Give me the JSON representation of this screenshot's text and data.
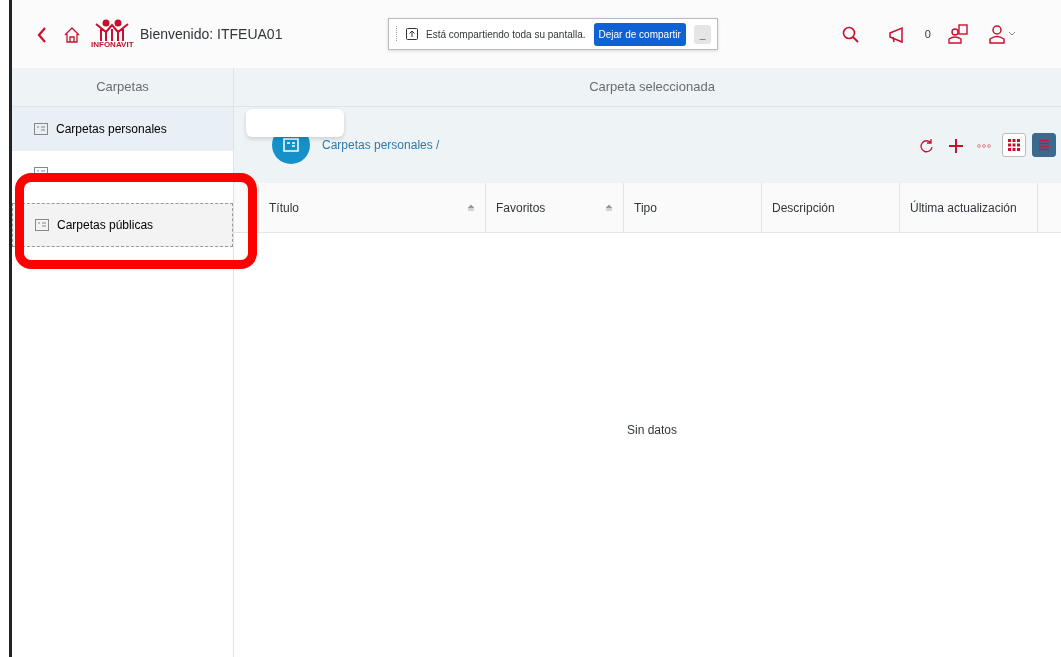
{
  "header": {
    "welcome": "Bienvenido: ITFEUA01",
    "logo_text": "INFONAVIT",
    "notification_count": "0"
  },
  "share_bar": {
    "message": "Está compartiendo toda su pantalla.",
    "stop_button": "Dejar de compartir",
    "minimize": "_"
  },
  "sidebar": {
    "title": "Carpetas",
    "items": [
      {
        "label": "Carpetas personales",
        "selected": true,
        "annotated": false
      },
      {
        "selected": false,
        "annotated": false
      },
      {
        "label": "Carpetas públicas",
        "selected": false,
        "annotated": true
      }
    ]
  },
  "main": {
    "title": "Carpeta seleccionada",
    "breadcrumb": "Carpetas personales /",
    "view_buttons": [
      {
        "kind": "grid",
        "selected": false
      },
      {
        "kind": "list",
        "selected": true
      }
    ],
    "table": {
      "columns": [
        {
          "label": "Título",
          "sortable": true
        },
        {
          "label": "Favoritos",
          "sortable": true
        },
        {
          "label": "Tipo",
          "sortable": false
        },
        {
          "label": "Descripción",
          "sortable": false
        },
        {
          "label": "Última actualización",
          "sortable": false
        }
      ],
      "empty_text": "Sin datos"
    }
  }
}
